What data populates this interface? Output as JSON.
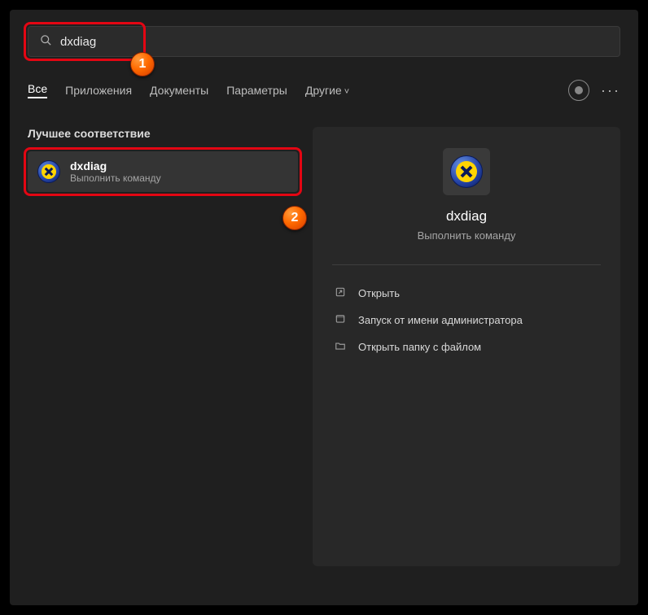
{
  "search": {
    "value": "dxdiag"
  },
  "tabs": {
    "all": "Все",
    "apps": "Приложения",
    "docs": "Документы",
    "params": "Параметры",
    "more": "Другие"
  },
  "section_label": "Лучшее соответствие",
  "result": {
    "title": "dxdiag",
    "subtitle": "Выполнить команду"
  },
  "detail": {
    "title": "dxdiag",
    "subtitle": "Выполнить команду"
  },
  "actions": {
    "open": "Открыть",
    "admin": "Запуск от имени администратора",
    "folder": "Открыть папку с файлом"
  },
  "badges": {
    "one": "1",
    "two": "2"
  }
}
